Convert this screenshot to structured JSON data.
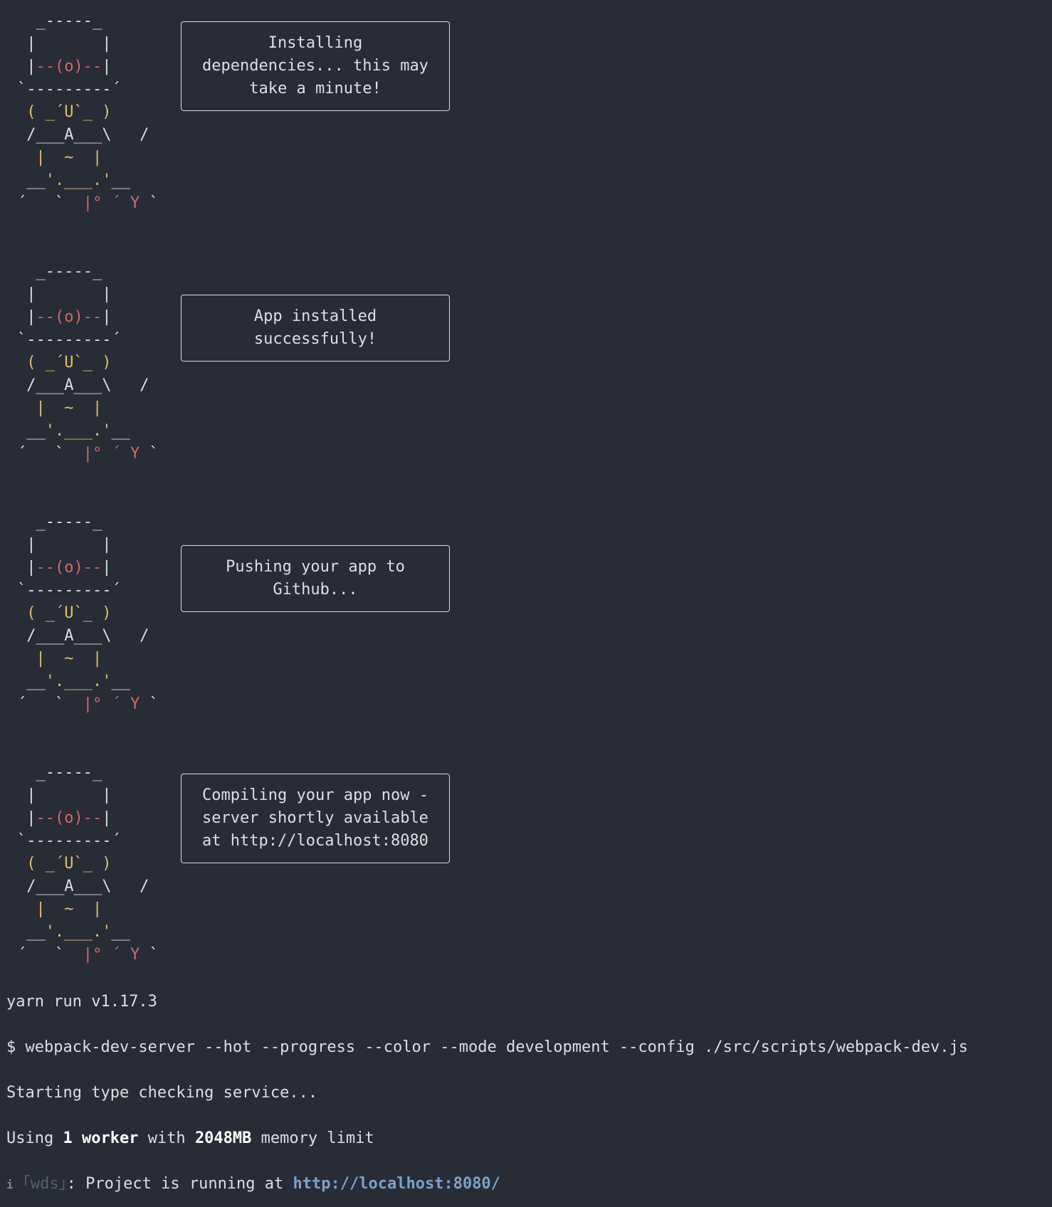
{
  "steps": [
    {
      "message": "Installing\ndependencies... this may\ntake a minute!"
    },
    {
      "message": "App installed\nsuccessfully!"
    },
    {
      "message": "Pushing your app to\nGithub..."
    },
    {
      "message": "Compiling your app now -\nserver shortly available\nat http://localhost:8080"
    }
  ],
  "robot": {
    "hat_top": "  _-----_",
    "hat_side": " |       |",
    "eye_left": " |",
    "eye": "--(o)--",
    "eye_right": "|",
    "brim": "`---------´",
    "mouth": " ( _´U`_ )",
    "body_a": " /___A___\\   /",
    "belly": "  |  ~  |",
    "legs_left": "__",
    "legs_mid": "'.___.'",
    "legs_right": "__",
    "feet_left": "´   `  ",
    "feet_mid": "|° ´ Y",
    "feet_right": " `"
  },
  "log": {
    "yarn_version": "yarn run v1.17.3",
    "command": "$ webpack-dev-server --hot --progress --color --mode development --config ./src/scripts/webpack-dev.js",
    "type_check": "Starting type checking service...",
    "using_prefix": "Using ",
    "workers": "1 worker",
    "with_text": " with ",
    "memory": "2048MB",
    "limit_text": " memory limit",
    "info_icon": "i",
    "wds_tag": "｢wds｣",
    "running_text": ": Project is running at ",
    "url": "http://localhost:8080/"
  },
  "colors": {
    "background": "#282c37",
    "text": "#dcdfe4",
    "robot_red": "#d3696c",
    "robot_yellow": "#e3bf6b",
    "link": "#7aa2c8"
  }
}
